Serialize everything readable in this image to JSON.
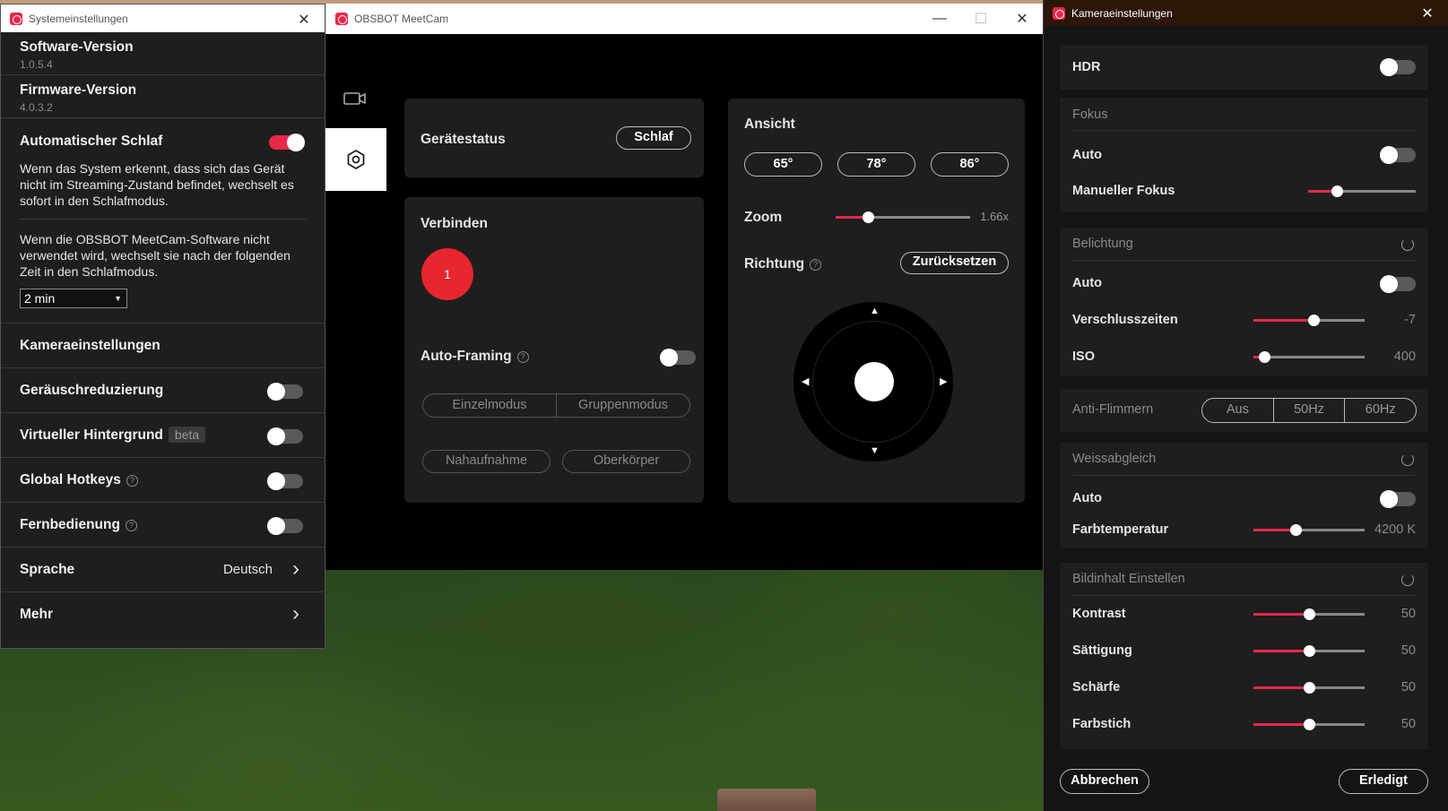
{
  "system_window": {
    "title": "Systemeinstellungen",
    "software_label": "Software-Version",
    "software_value": "1.0.5.4",
    "firmware_label": "Firmware-Version",
    "firmware_value": "4.0.3.2",
    "auto_sleep_label": "Automatischer Schlaf",
    "auto_sleep_on": true,
    "auto_sleep_desc": "Wenn das System erkennt, dass sich das Gerät nicht im Streaming-Zustand befindet, wechselt es sofort in den Schlafmodus.",
    "software_sleep_desc": "Wenn die OBSBOT MeetCam-Software nicht verwendet wird, wechselt sie nach der folgenden Zeit in den Schlafmodus.",
    "sleep_time_value": "2 min",
    "camera_settings_label": "Kameraeinstellungen",
    "noise_reduction_label": "Geräuschreduzierung",
    "virtual_bg_label": "Virtueller Hintergrund",
    "virtual_bg_badge": "beta",
    "global_hotkeys_label": "Global Hotkeys",
    "remote_label": "Fernbedienung",
    "help_glyph": "?",
    "language_label": "Sprache",
    "language_value": "Deutsch",
    "more_label": "Mehr"
  },
  "main_window": {
    "title": "OBSBOT MeetCam",
    "device_status_label": "Gerätestatus",
    "sleep_button": "Schlaf",
    "connect_label": "Verbinden",
    "device_number": "1",
    "device_color": "#e8262e",
    "auto_framing_label": "Auto-Framing",
    "mode_single": "Einzelmodus",
    "mode_group": "Gruppenmodus",
    "closeup": "Nahaufnahme",
    "upper_body": "Oberkörper",
    "view_label": "Ansicht",
    "fov_options": [
      "65°",
      "78°",
      "86°"
    ],
    "zoom_label": "Zoom",
    "zoom_value": "1.66x",
    "zoom_fraction": 0.24,
    "direction_label": "Richtung",
    "reset_button": "Zurücksetzen"
  },
  "camera_window": {
    "title": "Kameraeinstellungen",
    "hdr_label": "HDR",
    "focus_head": "Fokus",
    "focus_auto_label": "Auto",
    "manual_focus_label": "Manueller Fokus",
    "manual_focus_fraction": 0.27,
    "exposure_head": "Belichtung",
    "exposure_auto_label": "Auto",
    "shutter_label": "Verschlusszeiten",
    "shutter_value": "-7",
    "shutter_fraction": 0.54,
    "iso_label": "ISO",
    "iso_value": "400",
    "iso_fraction": 0.1,
    "antiflicker_head": "Anti-Flimmern",
    "antiflicker_options": [
      "Aus",
      "50Hz",
      "60Hz"
    ],
    "wb_head": "Weissabgleich",
    "wb_auto_label": "Auto",
    "color_temp_label": "Farbtemperatur",
    "color_temp_value": "4200 K",
    "color_temp_fraction": 0.38,
    "image_head": "Bildinhalt Einstellen",
    "contrast_label": "Kontrast",
    "contrast_value": "50",
    "saturation_label": "Sättigung",
    "saturation_value": "50",
    "sharpness_label": "Schärfe",
    "sharpness_value": "50",
    "tint_label": "Farbstich",
    "tint_value": "50",
    "image_fraction": 0.5,
    "cancel_button": "Abbrechen",
    "done_button": "Erledigt"
  },
  "colors": {
    "accent": "#e8294a",
    "panel": "#1e1e1e"
  },
  "icons": [
    "app-logo-icon",
    "close-icon",
    "minimize-icon",
    "maximize-icon",
    "camera-icon",
    "settings-icon",
    "help-icon",
    "chevron-right-icon",
    "dropdown-arrow-icon",
    "reset-icon",
    "arrow-up-icon",
    "arrow-down-icon",
    "arrow-left-icon",
    "arrow-right-icon"
  ]
}
